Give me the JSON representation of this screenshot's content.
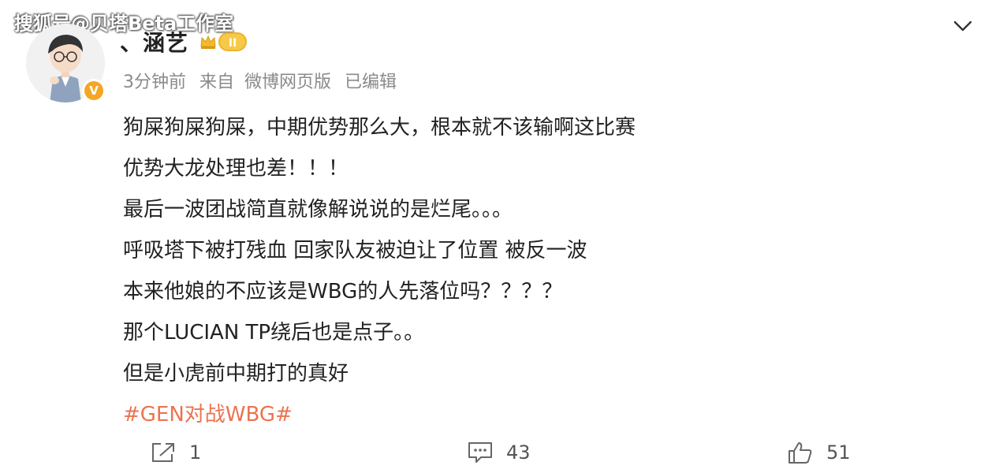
{
  "watermark": "搜狐号@贝塔Beta工作室",
  "user": {
    "name": "、涵艺",
    "verified_badge": "V",
    "level_label": "II"
  },
  "meta": {
    "time": "3分钟前",
    "source_prefix": "来自",
    "source": "微博网页版",
    "edited": "已编辑"
  },
  "post": {
    "lines": [
      "狗屎狗屎狗屎，中期优势那么大，根本就不该输啊这比赛",
      "优势大龙处理也差！！！",
      "最后一波团战简直就像解说说的是烂尾。。。",
      "呼吸塔下被打残血 回家队友被迫让了位置 被反一波",
      "本来他娘的不应该是WBG的人先落位吗？？？？",
      "那个LUCIAN TP绕后也是点子。。",
      "但是小虎前中期打的真好"
    ],
    "hashtag": "#GEN对战WBG#"
  },
  "actions": {
    "share_count": "1",
    "comment_count": "43",
    "like_count": "51"
  },
  "icons": {
    "share": "share-icon",
    "comment": "comment-icon",
    "like": "thumbs-up-icon",
    "more": "chevron-down-icon"
  },
  "colors": {
    "hashtag": "#eb7350",
    "verified": "#f5a623",
    "meta_text": "#8a8a8a",
    "body_text": "#222222"
  }
}
